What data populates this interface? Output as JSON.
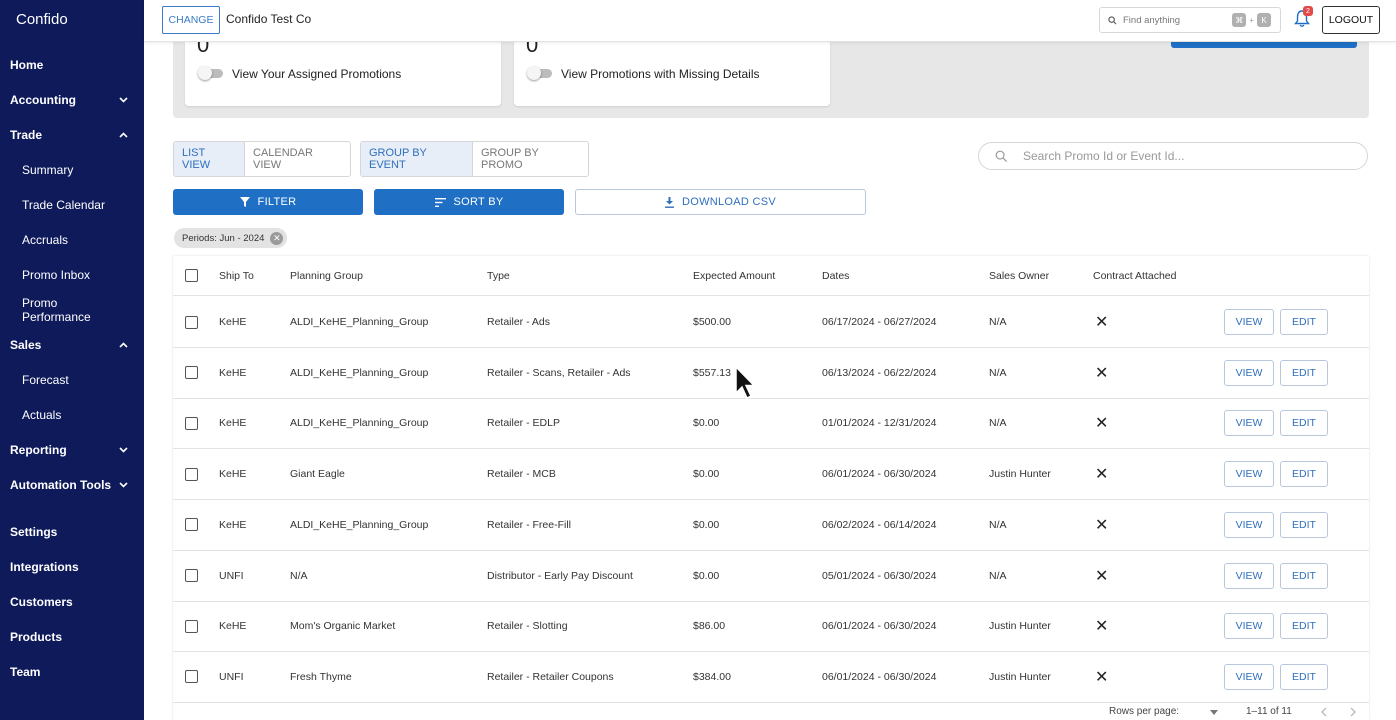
{
  "brand": "Confido",
  "sidebar": {
    "items": [
      {
        "label": "Home",
        "chevron": ""
      },
      {
        "label": "Accounting",
        "chevron": "down"
      },
      {
        "label": "Trade",
        "chevron": "up"
      },
      {
        "label": "Summary",
        "sub": true
      },
      {
        "label": "Trade Calendar",
        "sub": true
      },
      {
        "label": "Accruals",
        "sub": true
      },
      {
        "label": "Promo Inbox",
        "sub": true
      },
      {
        "label": "Promo Performance",
        "sub": true
      },
      {
        "label": "Sales",
        "chevron": "up"
      },
      {
        "label": "Forecast",
        "sub": true
      },
      {
        "label": "Actuals",
        "sub": true
      },
      {
        "label": "Reporting",
        "chevron": "down"
      },
      {
        "label": "Automation Tools",
        "chevron": "down"
      },
      {
        "label": "Settings",
        "chevron": ""
      },
      {
        "label": "Integrations",
        "chevron": ""
      },
      {
        "label": "Customers",
        "chevron": ""
      },
      {
        "label": "Products",
        "chevron": ""
      },
      {
        "label": "Team",
        "chevron": ""
      }
    ]
  },
  "topbar": {
    "change_label": "CHANGE",
    "company": "Confido Test Co",
    "find_placeholder": "Find anything",
    "kbd_cmd": "⌘",
    "kbd_plus": "+",
    "kbd_key": "K",
    "notif_count": "2",
    "logout_label": "LOGOUT"
  },
  "summary": {
    "card1": {
      "num": "0",
      "label": "View Your Assigned Promotions"
    },
    "card2": {
      "num": "0",
      "label": "View Promotions with Missing Details"
    }
  },
  "views": {
    "list": "LIST VIEW",
    "calendar": "CALENDAR VIEW",
    "group_event": "GROUP BY EVENT",
    "group_promo": "GROUP BY PROMO"
  },
  "search_placeholder": "Search Promo Id or Event Id...",
  "actions": {
    "filter": "FILTER",
    "sort": "SORT BY",
    "download": "DOWNLOAD CSV"
  },
  "chip": "Periods: Jun - 2024",
  "table": {
    "headers": [
      "Ship To",
      "Planning Group",
      "Type",
      "Expected Amount",
      "Dates",
      "Sales Owner",
      "Contract Attached"
    ],
    "rows": [
      [
        "KeHE",
        "ALDI_KeHE_Planning_Group",
        "Retailer - Ads",
        "$500.00",
        "06/17/2024 - 06/27/2024",
        "N/A"
      ],
      [
        "KeHE",
        "ALDI_KeHE_Planning_Group",
        "Retailer - Scans, Retailer - Ads",
        "$557.13",
        "06/13/2024 - 06/22/2024",
        "N/A"
      ],
      [
        "KeHE",
        "ALDI_KeHE_Planning_Group",
        "Retailer - EDLP",
        "$0.00",
        "01/01/2024 - 12/31/2024",
        "N/A"
      ],
      [
        "KeHE",
        "Giant Eagle",
        "Retailer - MCB",
        "$0.00",
        "06/01/2024 - 06/30/2024",
        "Justin Hunter"
      ],
      [
        "KeHE",
        "ALDI_KeHE_Planning_Group",
        "Retailer - Free-Fill",
        "$0.00",
        "06/02/2024 - 06/14/2024",
        "N/A"
      ],
      [
        "UNFI",
        "N/A",
        "Distributor - Early Pay Discount",
        "$0.00",
        "05/01/2024 - 06/30/2024",
        "N/A"
      ],
      [
        "KeHE",
        "Mom's Organic Market",
        "Retailer - Slotting",
        "$86.00",
        "06/01/2024 - 06/30/2024",
        "Justin Hunter"
      ],
      [
        "UNFI",
        "Fresh Thyme",
        "Retailer - Retailer Coupons",
        "$384.00",
        "06/01/2024 - 06/30/2024",
        "Justin Hunter"
      ]
    ],
    "contract_mark": "✕",
    "view_label": "VIEW",
    "edit_label": "EDIT"
  },
  "pagination": {
    "rows_per_page": "Rows per page:",
    "range": "1–11 of 11"
  },
  "colors": {
    "sidebar": "#0e1a5a",
    "primary": "#1f6fc5",
    "accent_text": "#2f6fbd"
  }
}
